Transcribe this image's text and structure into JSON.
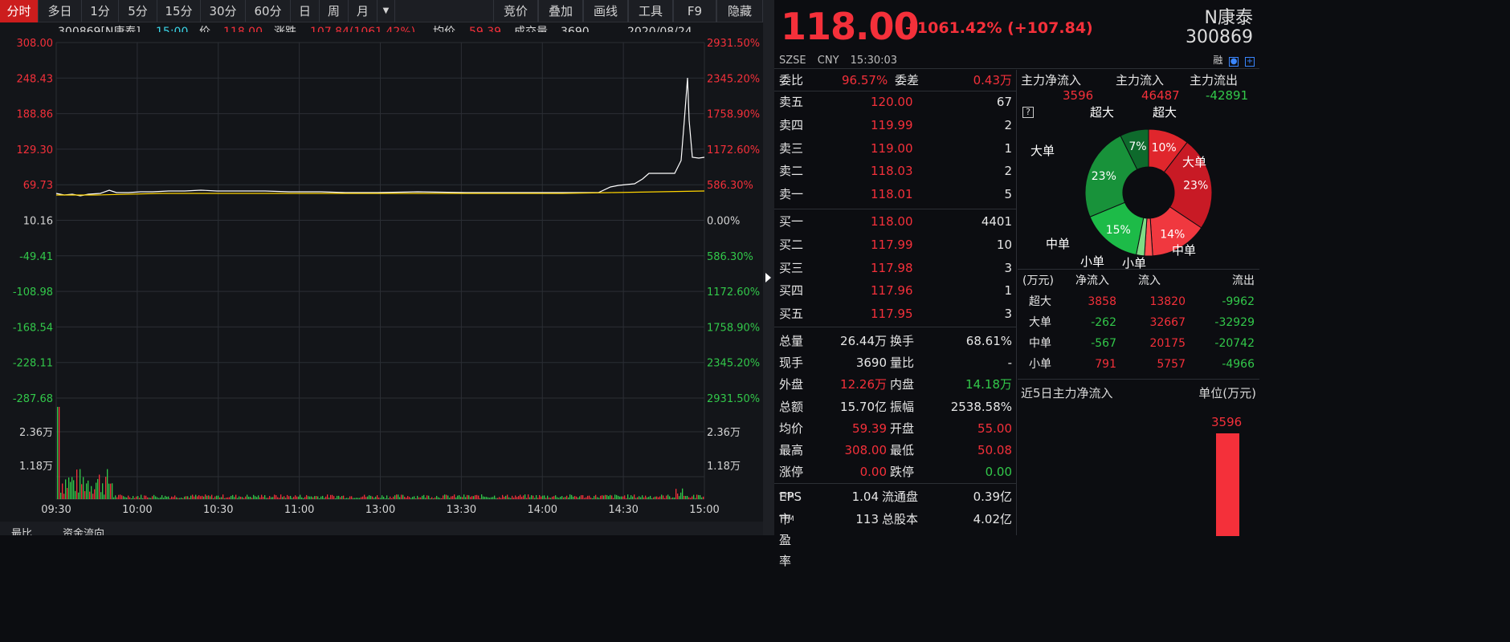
{
  "toolbar": {
    "tabs": [
      "分时",
      "多日",
      "1分",
      "5分",
      "15分",
      "30分",
      "60分",
      "日",
      "周",
      "月"
    ],
    "right": [
      "竞价",
      "叠加",
      "画线",
      "工具",
      "F9",
      "隐藏"
    ]
  },
  "info": {
    "code_name": "300869[N康泰]",
    "time": "15:00",
    "price_label": "价",
    "price": "118.00",
    "chg_label": "涨跌",
    "chg": "107.84(1061.42%)",
    "avg_label": "均价",
    "avg": "59.39",
    "vol_label": "成交量",
    "vol": "3690",
    "date": "2020/08/24"
  },
  "chart": {
    "left_axis": [
      "308.00",
      "248.43",
      "188.86",
      "129.30",
      "69.73",
      "10.16",
      "-49.41",
      "-108.98",
      "-168.54",
      "-228.11",
      "-287.68"
    ],
    "right_axis": [
      "2931.50%",
      "2345.20%",
      "1758.90%",
      "1172.60%",
      "586.30%",
      "0.00%",
      "586.30%",
      "1172.60%",
      "1758.90%",
      "2345.20%",
      "2931.50%"
    ],
    "vol_left": [
      "2.36万",
      "1.18万"
    ],
    "vol_right": [
      "2.36万",
      "1.18万"
    ],
    "times": [
      "09:30",
      "10:00",
      "10:30",
      "11:00",
      "13:00",
      "13:30",
      "14:00",
      "14:30",
      "15:00"
    ],
    "colors": {
      "up": "#f4303a",
      "down": "#32c84a",
      "price": "#ffffff",
      "avg": "#ffd400",
      "grid": "#2b2e34"
    }
  },
  "bottom_tabs": [
    "最比",
    "资金流向"
  ],
  "quote": {
    "price": "118.00",
    "change": "+1061.42% (+107.84)",
    "name": "N康泰",
    "code": "300869",
    "exchange": "SZSE",
    "currency": "CNY",
    "time": "15:30:03",
    "icons": [
      "融",
      "铃",
      "+"
    ]
  },
  "book": {
    "wei": {
      "l1": "委比",
      "v1": "96.57%",
      "l2": "委差",
      "v2": "0.43万"
    },
    "sells": [
      {
        "label": "卖五",
        "price": "120.00",
        "vol": "67"
      },
      {
        "label": "卖四",
        "price": "119.99",
        "vol": "2"
      },
      {
        "label": "卖三",
        "price": "119.00",
        "vol": "1"
      },
      {
        "label": "卖二",
        "price": "118.03",
        "vol": "2"
      },
      {
        "label": "卖一",
        "price": "118.01",
        "vol": "5"
      }
    ],
    "buys": [
      {
        "label": "买一",
        "price": "118.00",
        "vol": "4401"
      },
      {
        "label": "买二",
        "price": "117.99",
        "vol": "10"
      },
      {
        "label": "买三",
        "price": "117.98",
        "vol": "3"
      },
      {
        "label": "买四",
        "price": "117.96",
        "vol": "1"
      },
      {
        "label": "买五",
        "price": "117.95",
        "vol": "3"
      }
    ],
    "stats": [
      {
        "l1": "总量",
        "v1": "26.44万",
        "c1": "white",
        "l2": "换手",
        "v2": "68.61%",
        "c2": "white"
      },
      {
        "l1": "现手",
        "v1": "3690",
        "c1": "white",
        "l2": "量比",
        "v2": "-",
        "c2": "white"
      },
      {
        "l1": "外盘",
        "v1": "12.26万",
        "c1": "red",
        "l2": "内盘",
        "v2": "14.18万",
        "c2": "green"
      },
      {
        "l1": "总额",
        "v1": "15.70亿",
        "c1": "white",
        "l2": "振幅",
        "v2": "2538.58%",
        "c2": "white"
      },
      {
        "l1": "均价",
        "v1": "59.39",
        "c1": "red",
        "l2": "开盘",
        "v2": "55.00",
        "c2": "red"
      },
      {
        "l1": "最高",
        "v1": "308.00",
        "c1": "red",
        "l2": "最低",
        "v2": "50.08",
        "c2": "red"
      },
      {
        "l1": "涨停",
        "v1": "0.00",
        "c1": "red",
        "l2": "跌停",
        "v2": "0.00",
        "c2": "green"
      }
    ],
    "eps": {
      "l1": "EPS",
      "sup": "TTM",
      "v1": "1.04",
      "l2": "流通盘",
      "v2": "0.39亿"
    },
    "pe": {
      "l1": "市盈率",
      "sup": "TTM",
      "v1": "113",
      "l2": "总股本",
      "v2": "4.02亿"
    }
  },
  "flow": {
    "headers": [
      {
        "label": "主力净流入",
        "value": "3596",
        "c": "red"
      },
      {
        "label": "主力流入",
        "value": "46487",
        "c": "red"
      },
      {
        "label": "主力流出",
        "value": "-42891",
        "c": "green"
      }
    ],
    "pie": {
      "segments": [
        {
          "name": "超大流入",
          "pct": 10,
          "label": "10%",
          "color": "#e0262c"
        },
        {
          "name": "大单流入",
          "pct": 23,
          "label": "23%",
          "color": "#c81a25"
        },
        {
          "name": "中单流入",
          "pct": 14,
          "label": "14%",
          "color": "#f0383f"
        },
        {
          "name": "小单流入",
          "pct": 2,
          "label": "",
          "color": "#ff5050"
        },
        {
          "name": "小单流出",
          "pct": 2,
          "label": "",
          "color": "#7fdc86"
        },
        {
          "name": "中单流出",
          "pct": 15,
          "label": "15%",
          "color": "#1dbb48"
        },
        {
          "name": "大单流出",
          "pct": 23,
          "label": "23%",
          "color": "#18923a"
        },
        {
          "name": "超大流出",
          "pct": 7,
          "label": "7%",
          "color": "#0e6a2c"
        }
      ],
      "labels": {
        "super_l": "超大",
        "super_r": "超大",
        "large_l": "大单",
        "large_r": "大单",
        "mid_l": "中单",
        "mid_r": "中单",
        "small_l": "小单",
        "small_r": "小单"
      }
    },
    "table": {
      "headers": [
        "(万元)",
        "净流入",
        "流入",
        "流出"
      ],
      "rows": [
        {
          "name": "超大",
          "net": "3858",
          "net_c": "red",
          "in": "13820",
          "out": "-9962"
        },
        {
          "name": "大单",
          "net": "-262",
          "net_c": "green",
          "in": "32667",
          "out": "-32929"
        },
        {
          "name": "中单",
          "net": "-567",
          "net_c": "green",
          "in": "20175",
          "out": "-20742"
        },
        {
          "name": "小单",
          "net": "791",
          "net_c": "red",
          "in": "5757",
          "out": "-4966"
        }
      ]
    },
    "five_day": {
      "title": "近5日主力净流入",
      "unit": "单位(万元)",
      "value": "3596",
      "bar_color": "#f4303a"
    }
  }
}
